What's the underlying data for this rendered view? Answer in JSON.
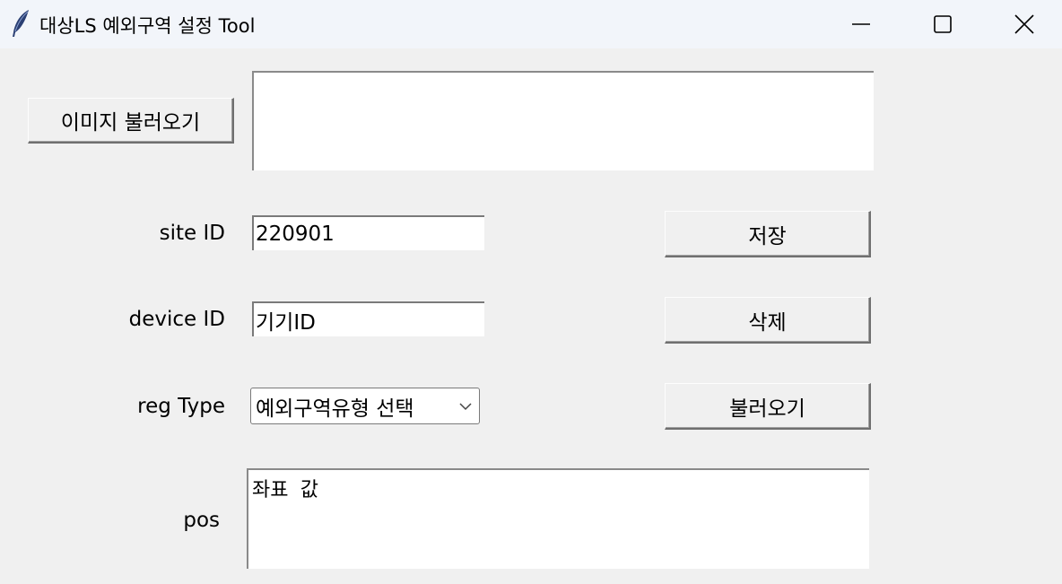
{
  "window": {
    "title": "대상LS 예외구역 설정 Tool",
    "icon": "feather-icon",
    "controls": [
      "minimize-icon",
      "maximize-icon",
      "close-icon"
    ]
  },
  "image": {
    "load_button_label": "이미지 불러오기",
    "path_value": ""
  },
  "form": {
    "site_id": {
      "label": "site ID",
      "value": "220901"
    },
    "device_id": {
      "label": "device ID",
      "value": "기기ID"
    },
    "reg_type": {
      "label": "reg Type",
      "selected": "예외구역유형 선택"
    },
    "pos": {
      "label": "pos",
      "value": "좌표 값"
    }
  },
  "actions": {
    "save_label": "저장",
    "delete_label": "삭제",
    "load_label": "불러오기"
  }
}
